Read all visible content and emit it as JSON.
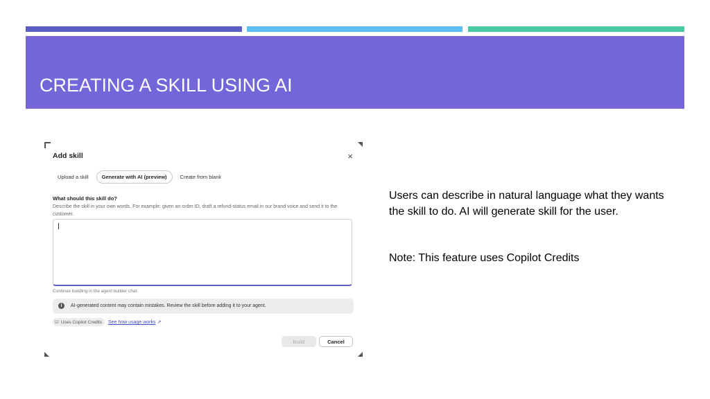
{
  "slide": {
    "title": "CREATING A SKILL USING AI",
    "colors": {
      "banner": "#7466d8",
      "bar_left": "#5a5fc3",
      "bar_middle": "#5bc0f0",
      "bar_right": "#4cc8a3"
    },
    "description": "Users can describe in natural language what they wants the skill to do. AI will generate skill for the user.",
    "note": "Note: This feature uses Copilot Credits"
  },
  "dialog": {
    "title": "Add skill",
    "close_icon": "×",
    "tabs": [
      {
        "label": "Upload a skill",
        "active": false
      },
      {
        "label": "Generate with AI (preview)",
        "active": true
      },
      {
        "label": "Create from blank",
        "active": false
      }
    ],
    "question_label": "What should this skill do?",
    "question_help": "Describe the skill in your own words. For example: given an order ID, draft a refund-status email in our brand voice and send it to the customer.",
    "input_value": "",
    "hint": "Continue building in the agent builder chat.",
    "notice": "AI-generated content may contain mistakes. Review the skill before adding it to your agent.",
    "notice_icon": "i",
    "credits_chip": "Uses Copilot Credits",
    "usage_link": "See how usage works",
    "external_link_icon": "↗",
    "build_label": "Build",
    "cancel_label": "Cancel",
    "accent_color": "#5b5fc7"
  }
}
